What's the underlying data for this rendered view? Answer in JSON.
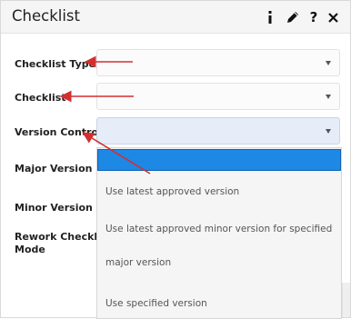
{
  "header": {
    "title": "Checklist",
    "icons": [
      "info-icon",
      "pencil-icon",
      "help-icon",
      "close-icon"
    ]
  },
  "form": {
    "checklist_type_label": "Checklist Type",
    "checklist_label": "Checklist",
    "version_control_label": "Version Control",
    "major_version_label": "Major Version No",
    "minor_version_label": "Minor Version No",
    "rework_label_line1": "Rework Checklist",
    "rework_label_line2": "Mode"
  },
  "dropdown": {
    "options": [
      "",
      "Use latest approved version",
      "Use latest approved minor version for specified",
      "major version",
      "Use specified version"
    ]
  },
  "colors": {
    "accent": "#1e88e5",
    "annotation_arrow": "#d32f2f"
  }
}
